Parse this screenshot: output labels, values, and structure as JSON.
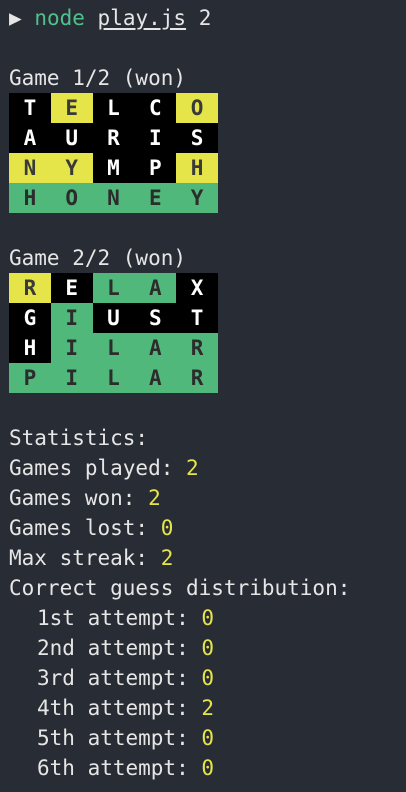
{
  "prompt": {
    "arrow": "▶",
    "command": "node",
    "file": "play.js",
    "arg": "2"
  },
  "games": [
    {
      "title": "Game 1/2 (won)",
      "rows": [
        [
          {
            "l": "T",
            "s": "absent"
          },
          {
            "l": "E",
            "s": "present"
          },
          {
            "l": "L",
            "s": "absent"
          },
          {
            "l": "C",
            "s": "absent"
          },
          {
            "l": "O",
            "s": "present"
          }
        ],
        [
          {
            "l": "A",
            "s": "absent"
          },
          {
            "l": "U",
            "s": "absent"
          },
          {
            "l": "R",
            "s": "absent"
          },
          {
            "l": "I",
            "s": "absent"
          },
          {
            "l": "S",
            "s": "absent"
          }
        ],
        [
          {
            "l": "N",
            "s": "present"
          },
          {
            "l": "Y",
            "s": "present"
          },
          {
            "l": "M",
            "s": "absent"
          },
          {
            "l": "P",
            "s": "absent"
          },
          {
            "l": "H",
            "s": "present"
          }
        ],
        [
          {
            "l": "H",
            "s": "correct"
          },
          {
            "l": "O",
            "s": "correct"
          },
          {
            "l": "N",
            "s": "correct"
          },
          {
            "l": "E",
            "s": "correct"
          },
          {
            "l": "Y",
            "s": "correct"
          }
        ]
      ]
    },
    {
      "title": "Game 2/2 (won)",
      "rows": [
        [
          {
            "l": "R",
            "s": "present"
          },
          {
            "l": "E",
            "s": "absent"
          },
          {
            "l": "L",
            "s": "correct"
          },
          {
            "l": "A",
            "s": "correct"
          },
          {
            "l": "X",
            "s": "absent"
          }
        ],
        [
          {
            "l": "G",
            "s": "absent"
          },
          {
            "l": "I",
            "s": "correct"
          },
          {
            "l": "U",
            "s": "absent"
          },
          {
            "l": "S",
            "s": "absent"
          },
          {
            "l": "T",
            "s": "absent"
          }
        ],
        [
          {
            "l": "H",
            "s": "absent"
          },
          {
            "l": "I",
            "s": "correct"
          },
          {
            "l": "L",
            "s": "correct"
          },
          {
            "l": "A",
            "s": "correct"
          },
          {
            "l": "R",
            "s": "correct"
          }
        ],
        [
          {
            "l": "P",
            "s": "correct"
          },
          {
            "l": "I",
            "s": "correct"
          },
          {
            "l": "L",
            "s": "correct"
          },
          {
            "l": "A",
            "s": "correct"
          },
          {
            "l": "R",
            "s": "correct"
          }
        ]
      ]
    }
  ],
  "stats": {
    "heading": "Statistics:",
    "played_label": "Games played: ",
    "played": "2",
    "won_label": "Games won: ",
    "won": "2",
    "lost_label": "Games lost: ",
    "lost": "0",
    "streak_label": "Max streak: ",
    "streak": "2",
    "dist_heading": "Correct guess distribution:",
    "distribution": [
      {
        "label": "1st attempt: ",
        "value": "0"
      },
      {
        "label": "2nd attempt: ",
        "value": "0"
      },
      {
        "label": "3rd attempt: ",
        "value": "0"
      },
      {
        "label": "4th attempt: ",
        "value": "2"
      },
      {
        "label": "5th attempt: ",
        "value": "0"
      },
      {
        "label": "6th attempt: ",
        "value": "0"
      }
    ]
  },
  "colors": {
    "background": "#282c34",
    "absent": "#000000",
    "present": "#e5e54a",
    "correct": "#4fb87a",
    "number": "#e5e54a",
    "command": "#4fc28c"
  }
}
